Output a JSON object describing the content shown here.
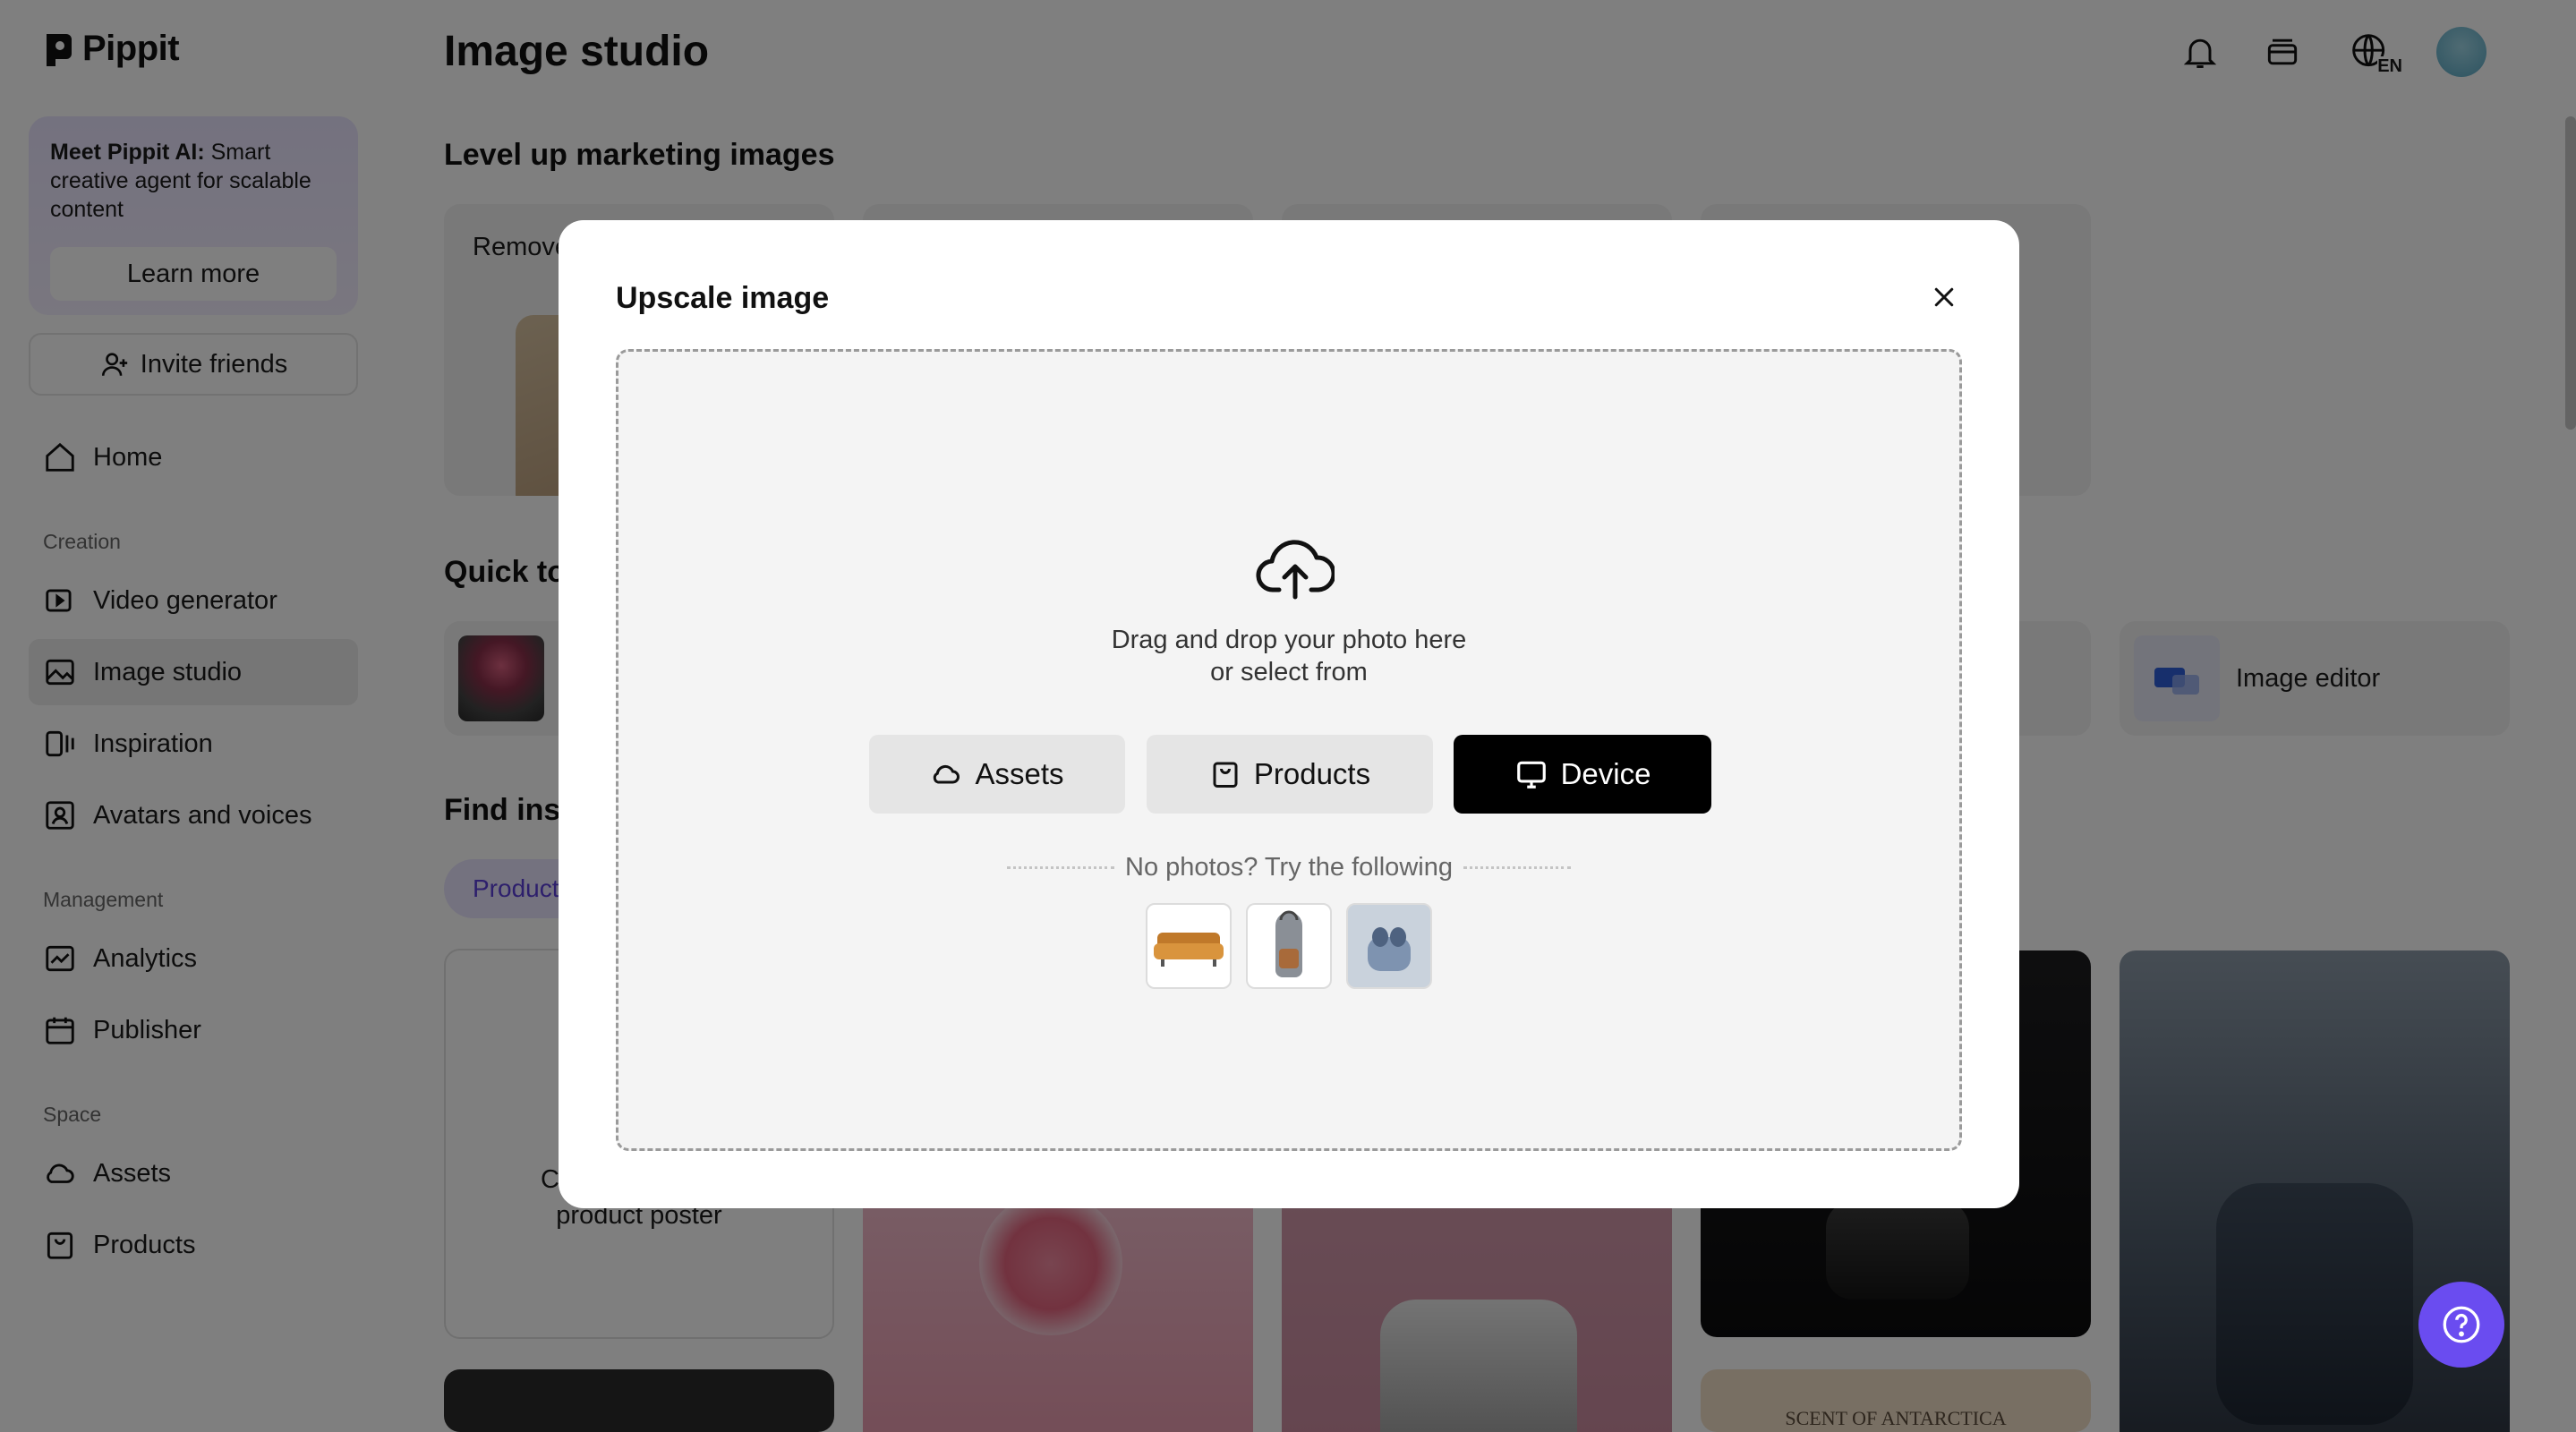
{
  "app": {
    "name": "Pippit"
  },
  "sidebar": {
    "promo": {
      "title": "Meet Pippit AI:",
      "text": " Smart creative agent for scalable content",
      "button": "Learn more"
    },
    "invite": "Invite friends",
    "home": "Home",
    "sections": {
      "creation": "Creation",
      "management": "Management",
      "space": "Space"
    },
    "items": {
      "video_generator": "Video generator",
      "image_studio": "Image studio",
      "inspiration": "Inspiration",
      "avatars": "Avatars and voices",
      "analytics": "Analytics",
      "publisher": "Publisher",
      "assets": "Assets",
      "products": "Products"
    },
    "active": "Image studio"
  },
  "header": {
    "title": "Image studio",
    "language_badge": "EN"
  },
  "main": {
    "section1_title": "Level up marketing images",
    "tool_card_label": "Remove",
    "section2_title": "Quick to",
    "quick_card_right": "Image editor",
    "section3_title": "Find insp",
    "tab_pill": "Product",
    "poster_card_text_1": "C",
    "poster_card_text_2": "product poster",
    "antarctica_caption": "SCENT OF ANTARCTICA"
  },
  "modal": {
    "title": "Upscale image",
    "drop_line1": "Drag and drop your photo here",
    "drop_line2": "or select from",
    "buttons": {
      "assets": "Assets",
      "products": "Products",
      "device": "Device"
    },
    "suggest_text": "No photos? Try the following",
    "samples": [
      "sofa",
      "backpack",
      "earbuds"
    ]
  },
  "colors": {
    "accent": "#6a4cf0",
    "promo_bg": "#e9e4ff",
    "overlay": "rgba(0,0,0,0.5)",
    "primary_button": "#000000"
  }
}
